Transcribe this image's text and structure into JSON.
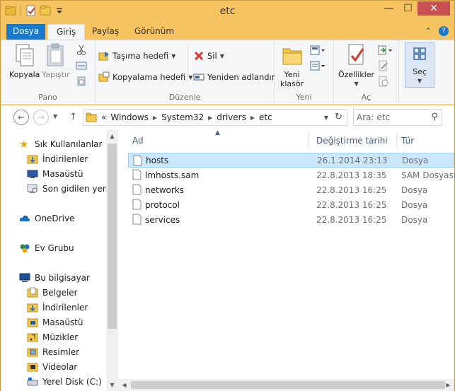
{
  "window": {
    "title": "etc"
  },
  "window_buttons": {
    "minimize": "—",
    "maximize": "☐",
    "close": "✕"
  },
  "tabs": [
    {
      "label": "Dosya"
    },
    {
      "label": "Giriş"
    },
    {
      "label": "Paylaş"
    },
    {
      "label": "Görünüm"
    }
  ],
  "ribbon": {
    "pano": {
      "label": "Pano",
      "kopyala": "Kopyala",
      "yapistir": "Yapıştır"
    },
    "duzenle": {
      "label": "Düzenle",
      "tasima": "Taşıma hedefi",
      "kopyalama": "Kopyalama hedefi",
      "sil": "Sil",
      "yeniden": "Yeniden adlandır"
    },
    "yeni": {
      "label": "Yeni",
      "yeni_klasor_1": "Yeni",
      "yeni_klasor_2": "klasör"
    },
    "ac": {
      "label": "Aç",
      "ozellikler": "Özellikler"
    },
    "sec": {
      "label": "Seç"
    }
  },
  "address": {
    "overflow": "«",
    "crumbs": [
      "Windows",
      "System32",
      "drivers",
      "etc"
    ],
    "search_placeholder": "Ara: etc"
  },
  "nav": {
    "favorites": "Sık Kullanılanlar",
    "downloads": "İndirilenler",
    "desktop": "Masaüstü",
    "recent": "Son gidilen yerler",
    "onedrive": "OneDrive",
    "homegroup": "Ev Grubu",
    "thispc": "Bu bilgisayar",
    "documents": "Belgeler",
    "downloads2": "İndirilenler",
    "desktop2": "Masaüstü",
    "music": "Müzikler",
    "pictures": "Resimler",
    "videos": "Videolar",
    "localdisk": "Yerel Disk (C:)"
  },
  "columns": {
    "name": "Ad",
    "date": "Değiştirme tarihi",
    "type": "Tür"
  },
  "files": [
    {
      "name": "hosts",
      "date": "26.1.2014 23:13",
      "type": "Dosya"
    },
    {
      "name": "lmhosts.sam",
      "date": "22.8.2013 18:35",
      "type": "SAM Dosyası"
    },
    {
      "name": "networks",
      "date": "22.8.2013 16:25",
      "type": "Dosya"
    },
    {
      "name": "protocol",
      "date": "22.8.2013 16:25",
      "type": "Dosya"
    },
    {
      "name": "services",
      "date": "22.8.2013 16:25",
      "type": "Dosya"
    }
  ],
  "colors": {
    "accent": "#1979ca",
    "titlebar": "#f5c460",
    "selection": "#cce8ff"
  }
}
